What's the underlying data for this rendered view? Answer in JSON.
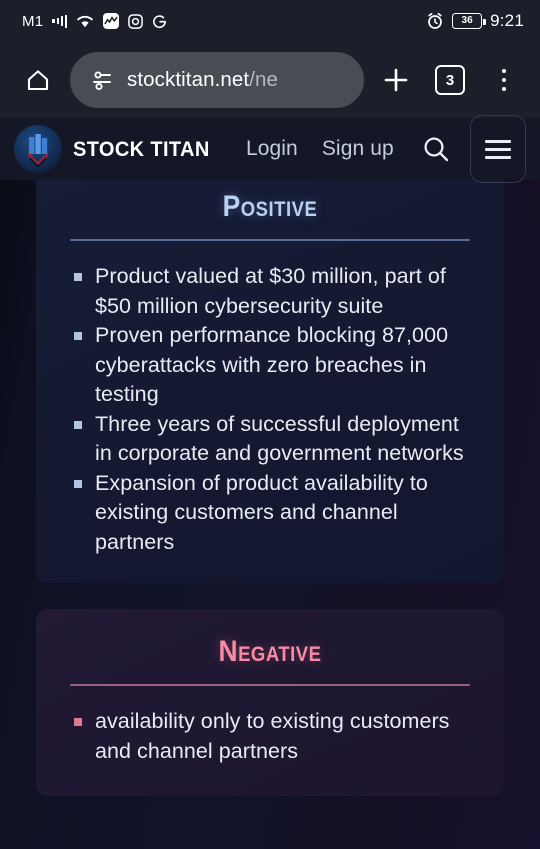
{
  "statusbar": {
    "carrier": "M1",
    "time": "9:21",
    "battery_level": "36",
    "icons": [
      "signal-bars-icon",
      "wifi-icon",
      "stock-app-icon",
      "instagram-icon",
      "google-icon",
      "alarm-clock-icon",
      "battery-icon"
    ]
  },
  "browser": {
    "home_label": "home-icon",
    "url_main": "stocktitan.net",
    "url_path": "/ne",
    "new_tab_label": "+",
    "tab_count": "3",
    "menu_label": "overflow-menu-icon"
  },
  "site": {
    "brand": "STOCK TITAN",
    "login_label": "Login",
    "signup_label": "Sign up",
    "search_label": "search-icon",
    "menu_label": "hamburger-menu-icon"
  },
  "sections": {
    "positive": {
      "title": "Positive",
      "accent": "#b9d2f2",
      "bullets": [
        "Product valued at $30 million, part of $50 million cybersecurity suite",
        "Proven performance blocking 87,000 cyberattacks with zero breaches in testing",
        "Three years of successful deployment in corporate and government networks",
        "Expansion of product availability to existing customers and channel partners"
      ]
    },
    "negative": {
      "title": "Negative",
      "accent": "#f58ba4",
      "bullets": [
        "availability only to existing customers and channel partners"
      ]
    }
  }
}
